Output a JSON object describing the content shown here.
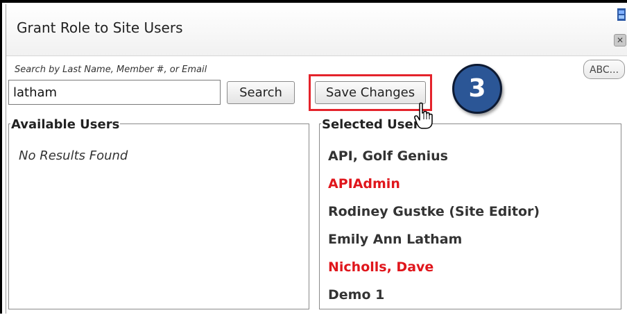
{
  "dialog": {
    "title": "Grant Role to Site Users",
    "close_glyph": "✕",
    "search_hint": "Search by Last Name, Member #, or Email",
    "search_value": "latham",
    "search_label": "Search",
    "save_label": "Save Changes",
    "abc_label": "ABC...",
    "step_number": "3"
  },
  "available": {
    "legend": "Available Users",
    "empty_text": "No Results Found"
  },
  "selected": {
    "legend": "Selected Users",
    "users": [
      {
        "name": "API, Golf Genius",
        "color": "#333333"
      },
      {
        "name": "APIAdmin",
        "color": "#e0161c"
      },
      {
        "name": "Rodiney Gustke (Site Editor)",
        "color": "#333333"
      },
      {
        "name": "Emily Ann Latham",
        "color": "#333333"
      },
      {
        "name": "Nicholls, Dave",
        "color": "#e0161c"
      },
      {
        "name": "Demo 1",
        "color": "#333333"
      }
    ]
  },
  "colors": {
    "highlight": "#e4232b",
    "badge": "#2b5696",
    "alert_text": "#e0161c"
  }
}
